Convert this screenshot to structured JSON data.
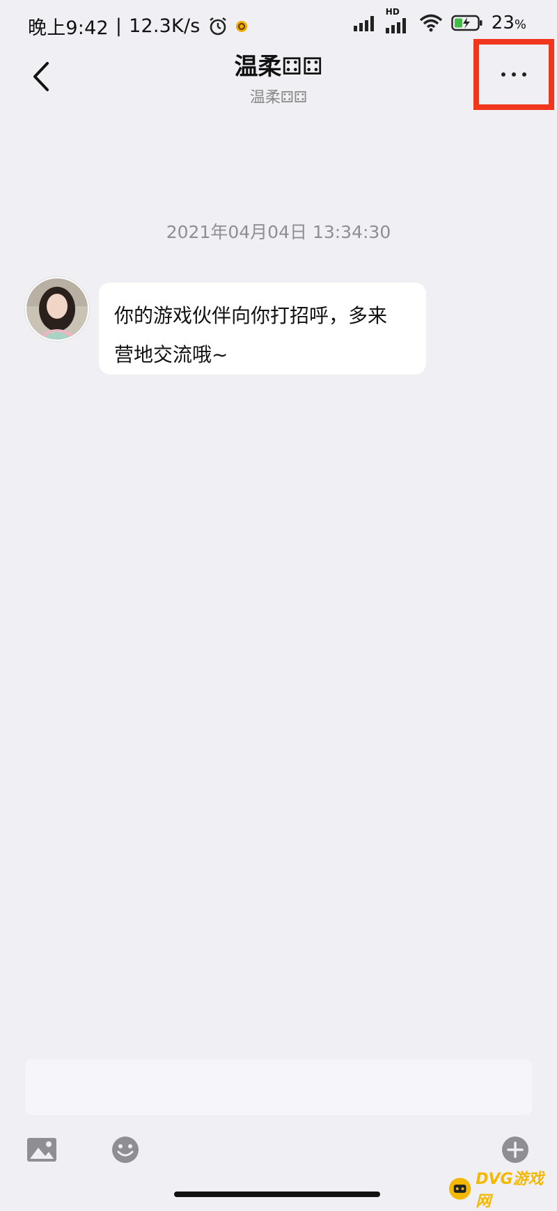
{
  "status_bar": {
    "time": "晚上9:42",
    "net_speed": "12.3K/s",
    "network_hd": "HD",
    "battery_percent": "23",
    "battery_unit": "%"
  },
  "header": {
    "title": "温柔⚃⚃",
    "subtitle": "温柔⚃⚃"
  },
  "chat": {
    "timestamp": "2021年04月04日 13:34:30",
    "messages": [
      {
        "line1": "你的游戏伙伴向你打招呼，多来",
        "line2": "营地交流哦~"
      }
    ]
  },
  "input": {
    "placeholder": ""
  },
  "icons": [
    "back-icon",
    "more-icon",
    "image-icon",
    "emoji-icon",
    "plus-icon"
  ],
  "colors": {
    "background": "#efeff4",
    "highlight": "#f0371e",
    "bubble": "#ffffff"
  },
  "watermark": {
    "text": "DVG游戏网"
  }
}
